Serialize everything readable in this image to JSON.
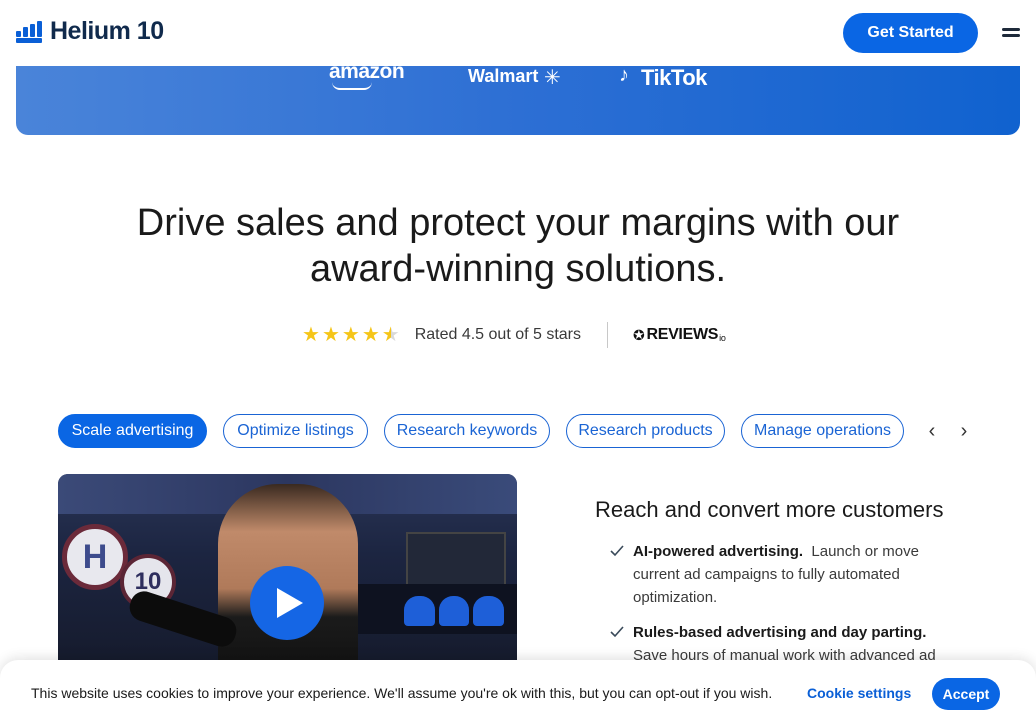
{
  "header": {
    "logo_text": "Helium 10",
    "cta_label": "Get Started"
  },
  "banner": {
    "marketplaces": [
      "amazon",
      "Walmart",
      "TikTok"
    ]
  },
  "hero": {
    "headline_line1": "Drive sales and protect your margins with our",
    "headline_line2": "award-winning solutions."
  },
  "rating": {
    "stars": 4.5,
    "text": "Rated 4.5 out of 5 stars",
    "reviews_brand": "REVIEWS",
    "reviews_suffix": "io"
  },
  "tabs": [
    {
      "label": "Scale advertising",
      "active": true
    },
    {
      "label": "Optimize listings",
      "active": false
    },
    {
      "label": "Research keywords",
      "active": false
    },
    {
      "label": "Research products",
      "active": false
    },
    {
      "label": "Manage operations",
      "active": false
    }
  ],
  "video": {
    "badge1": "H",
    "badge2": "10"
  },
  "feature": {
    "title": "Reach and convert more customers",
    "items": [
      {
        "bold": "AI-powered advertising.",
        "text": "Launch or move current ad campaigns to fully automated optimization."
      },
      {
        "bold": "Rules-based advertising and day parting.",
        "text": "Save hours of manual work with advanced ad"
      }
    ]
  },
  "cookie": {
    "message": "This website uses cookies to improve your experience. We'll assume you're ok with this, but you can opt-out if you wish.",
    "settings_label": "Cookie settings",
    "accept_label": "Accept"
  },
  "colors": {
    "primary": "#0a66e4",
    "star": "#f5c518",
    "banner_end": "#1062cf"
  }
}
